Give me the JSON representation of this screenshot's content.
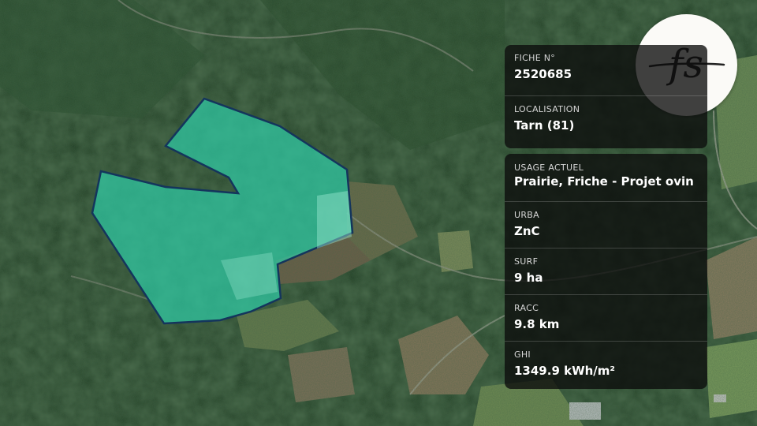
{
  "colors": {
    "parcel_fill": "#2fcaa5",
    "parcel_stroke": "#14355c",
    "panel_bg": "#0c0c0c",
    "label_text": "#d6d6d6",
    "value_text": "#ffffff",
    "logo_bg": "#fbfaf7",
    "logo_ink": "#222222"
  },
  "map": {
    "type": "satellite",
    "parcel_highlighted": true
  },
  "logo": {
    "icon": "fs-monogram-logo",
    "text": "fs"
  },
  "info": {
    "fiche": {
      "label": "FICHE N°",
      "value": "2520685"
    },
    "localisation": {
      "label": "LOCALISATION",
      "value": "Tarn (81)"
    },
    "usage": {
      "label": "USAGE ACTUEL",
      "value": "Prairie, Friche - Projet ovin"
    },
    "urba": {
      "label": "URBA",
      "value": "ZnC"
    },
    "surf": {
      "label": "SURF",
      "value": "9 ha"
    },
    "racc": {
      "label": "RACC",
      "value": "9.8 km"
    },
    "ghi": {
      "label": "GHI",
      "value": "1349.9 kWh/m²"
    }
  }
}
